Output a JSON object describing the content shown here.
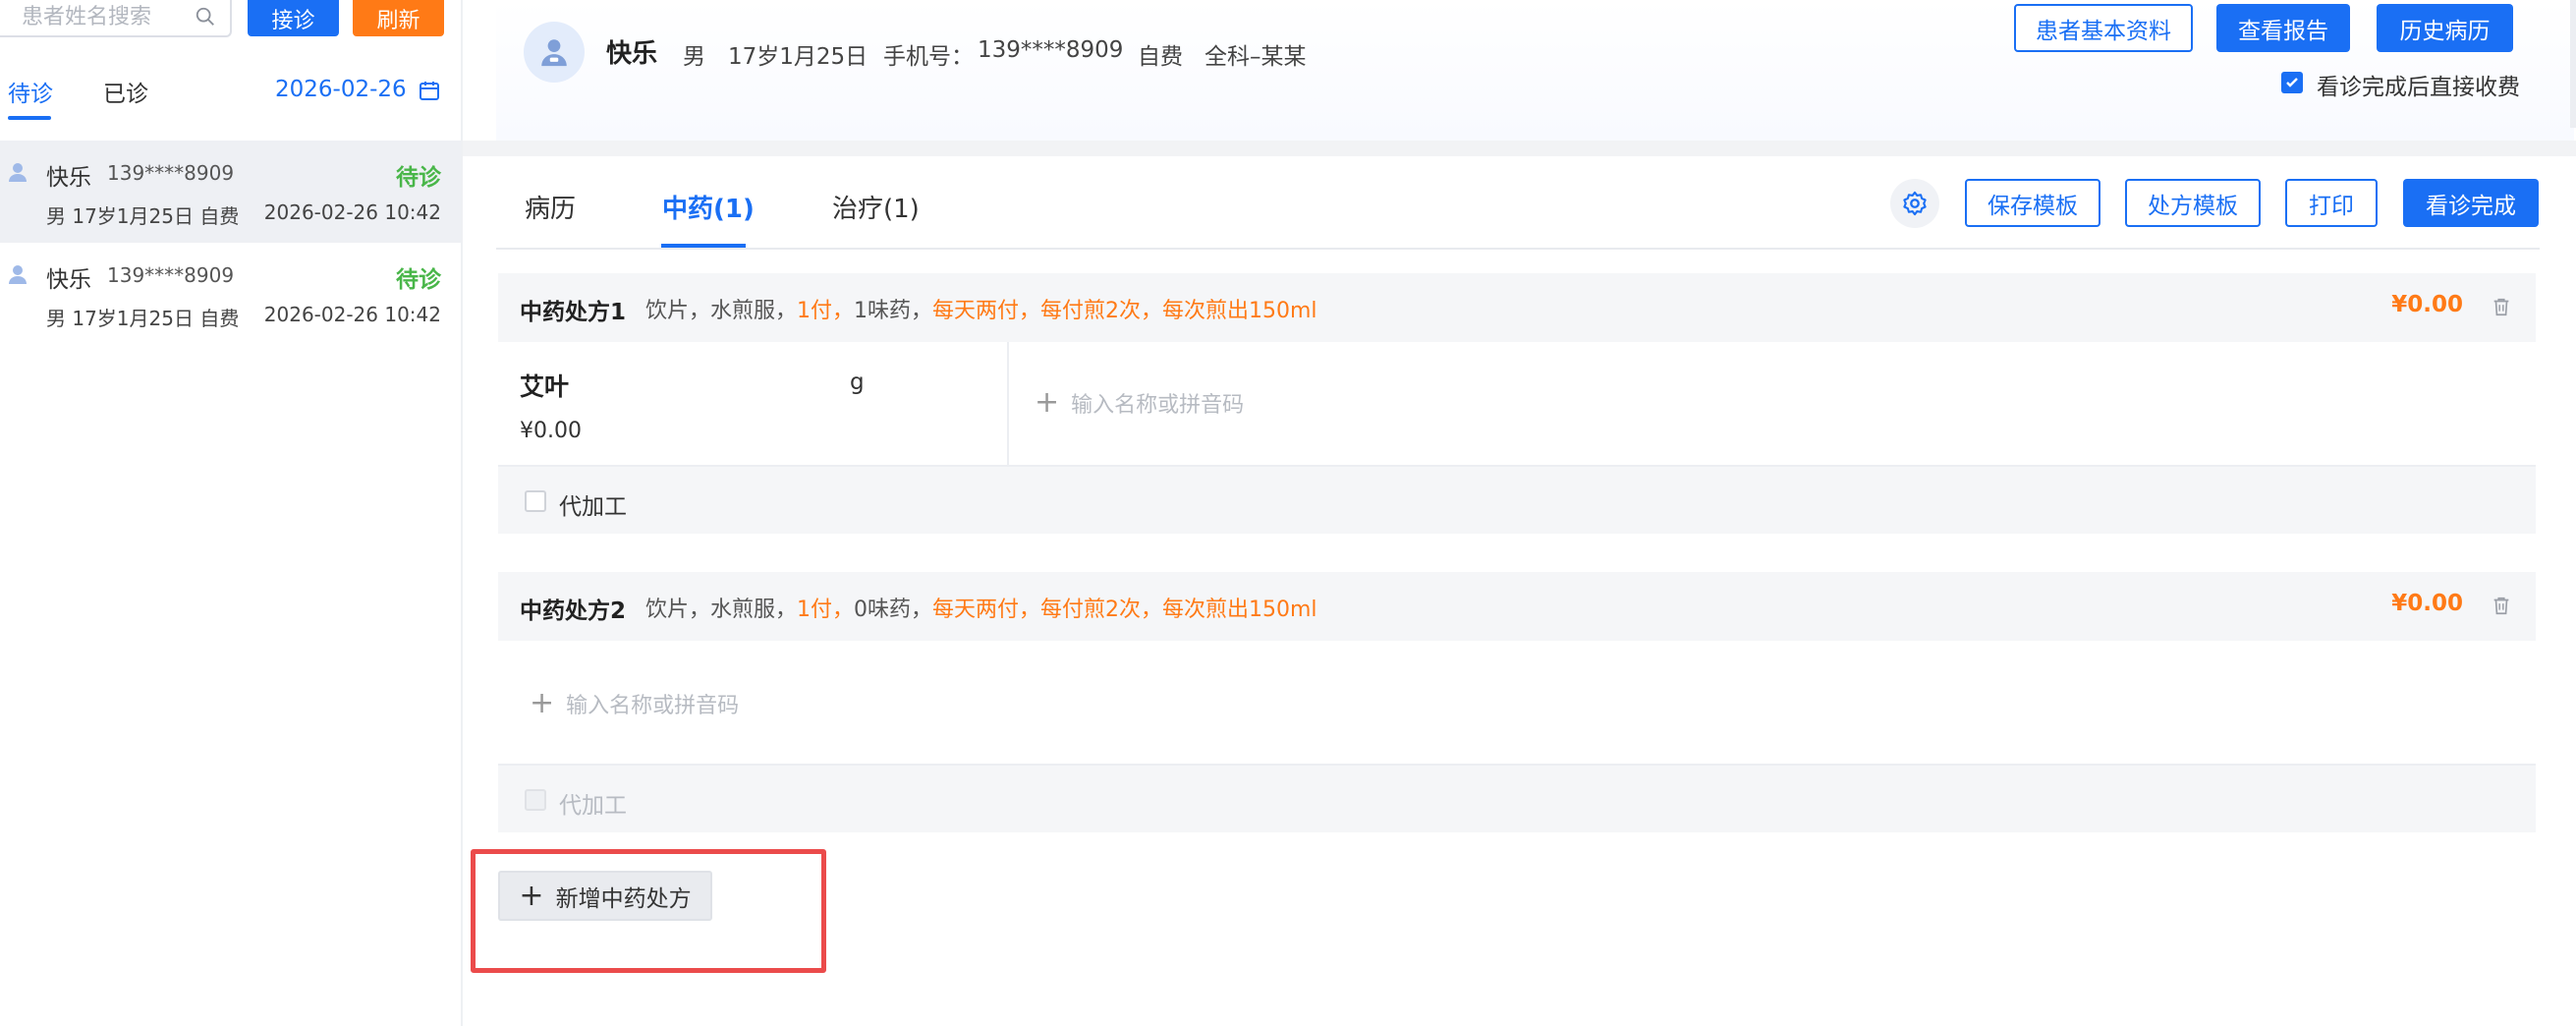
{
  "left_panel": {
    "search_placeholder": "患者姓名搜索",
    "btn_receive": "接诊",
    "btn_refresh": "刷新",
    "tab_waiting": "待诊",
    "tab_done": "已诊",
    "date": "2026-02-26",
    "patients": [
      {
        "name": "快乐",
        "phone": "139****8909",
        "status": "待诊",
        "info": "男  17岁1月25日  自费",
        "time": "2026-02-26 10:42"
      },
      {
        "name": "快乐",
        "phone": "139****8909",
        "status": "待诊",
        "info": "男  17岁1月25日  自费",
        "time": "2026-02-26 10:42"
      }
    ]
  },
  "patient_bar": {
    "name": "快乐",
    "gender": "男",
    "age": "17岁1月25日",
    "phone_label": "手机号：",
    "phone": "139****8909",
    "payment": "自费",
    "department": "全科–某某",
    "btn_basic_info": "患者基本资料",
    "btn_report": "查看报告",
    "btn_history": "历史病历",
    "auto_charge_label": "看诊完成后直接收费",
    "auto_charge_checked": true
  },
  "main_tabs": {
    "record": "病历",
    "herbal": "中药(1)",
    "treatment": "治疗(1)",
    "btn_save_template": "保存模板",
    "btn_rx_template": "处方模板",
    "btn_print": "打印",
    "btn_finish": "看诊完成"
  },
  "prescriptions": [
    {
      "title": "中药处方1",
      "desc_prefix": "饮片，水煎服，",
      "desc_doses": "1付，",
      "desc_count": "1味药，",
      "desc_usage": "每天两付，每付煎2次，每次煎出150ml",
      "price": "¥0.00",
      "herbs": [
        {
          "name": "艾叶",
          "unit": "g",
          "price": "¥0.00"
        }
      ],
      "add_placeholder": "输入名称或拼音码",
      "process_label": "代加工"
    },
    {
      "title": "中药处方2",
      "desc_prefix": "饮片，水煎服，",
      "desc_doses": "1付，",
      "desc_count": "0味药，",
      "desc_usage": "每天两付，每付煎2次，每次煎出150ml",
      "price": "¥0.00",
      "herbs": [],
      "add_placeholder": "输入名称或拼音码",
      "process_label": "代加工"
    }
  ],
  "btn_add_rx": "新增中药处方",
  "colors": {
    "primary": "#1a6ff4",
    "orange": "#ff7a16",
    "green": "#49b649",
    "highlight": "#eb4b4b"
  }
}
